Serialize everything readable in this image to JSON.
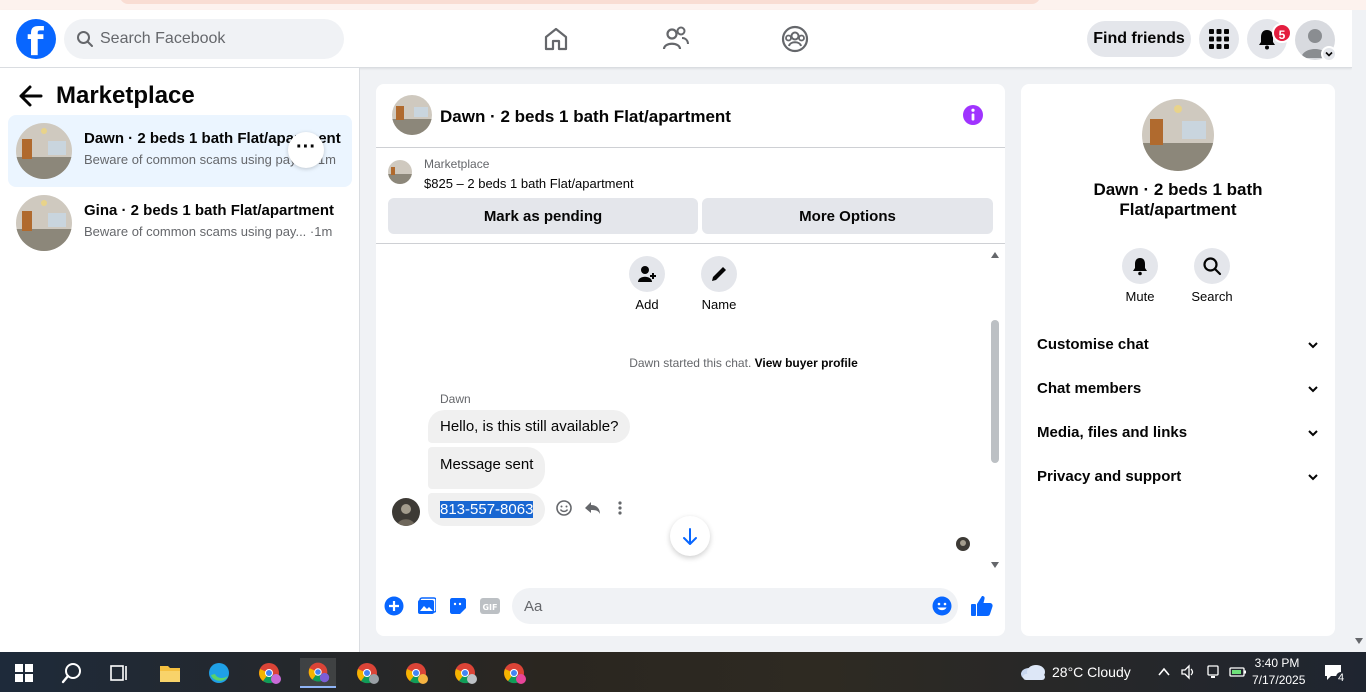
{
  "header": {
    "search_placeholder": "Search Facebook",
    "find_friends": "Find friends",
    "notification_count": "5"
  },
  "sidebar": {
    "title": "Marketplace",
    "conversations": [
      {
        "name": "Dawn · 2 beds 1 bath Flat/apartment",
        "snippet": "Beware of common scams using pay...",
        "time": "1m",
        "active": true
      },
      {
        "name": "Gina · 2 beds 1 bath Flat/apartment",
        "snippet": "Beware of common scams using pay...",
        "time": "1m",
        "active": false
      }
    ]
  },
  "chat": {
    "title": "Dawn · 2 beds 1 bath Flat/apartment",
    "listing_source": "Marketplace",
    "listing_price": "$825 – 2 beds 1 bath Flat/apartment",
    "mark_pending": "Mark as pending",
    "more_options": "More Options",
    "add_label": "Add",
    "name_label": "Name",
    "started_text": "Dawn started this chat.",
    "view_profile": "View buyer profile",
    "sender": "Dawn",
    "messages": [
      "Hello, is this still available?",
      "Message sent",
      "813-557-8063"
    ],
    "composer_placeholder": "Aa"
  },
  "info": {
    "title_line1": "Dawn · 2 beds 1 bath",
    "title_line2": "Flat/apartment",
    "mute": "Mute",
    "search": "Search",
    "sections": [
      "Customise chat",
      "Chat members",
      "Media, files and links",
      "Privacy and support"
    ]
  },
  "taskbar": {
    "weather": "28°C  Cloudy",
    "time": "3:40 PM",
    "date": "7/17/2025",
    "notifications": "4"
  },
  "colors": {
    "brand": "#0866ff",
    "messenger_purple": "#a033ff",
    "active_item": "#ebf5ff"
  }
}
